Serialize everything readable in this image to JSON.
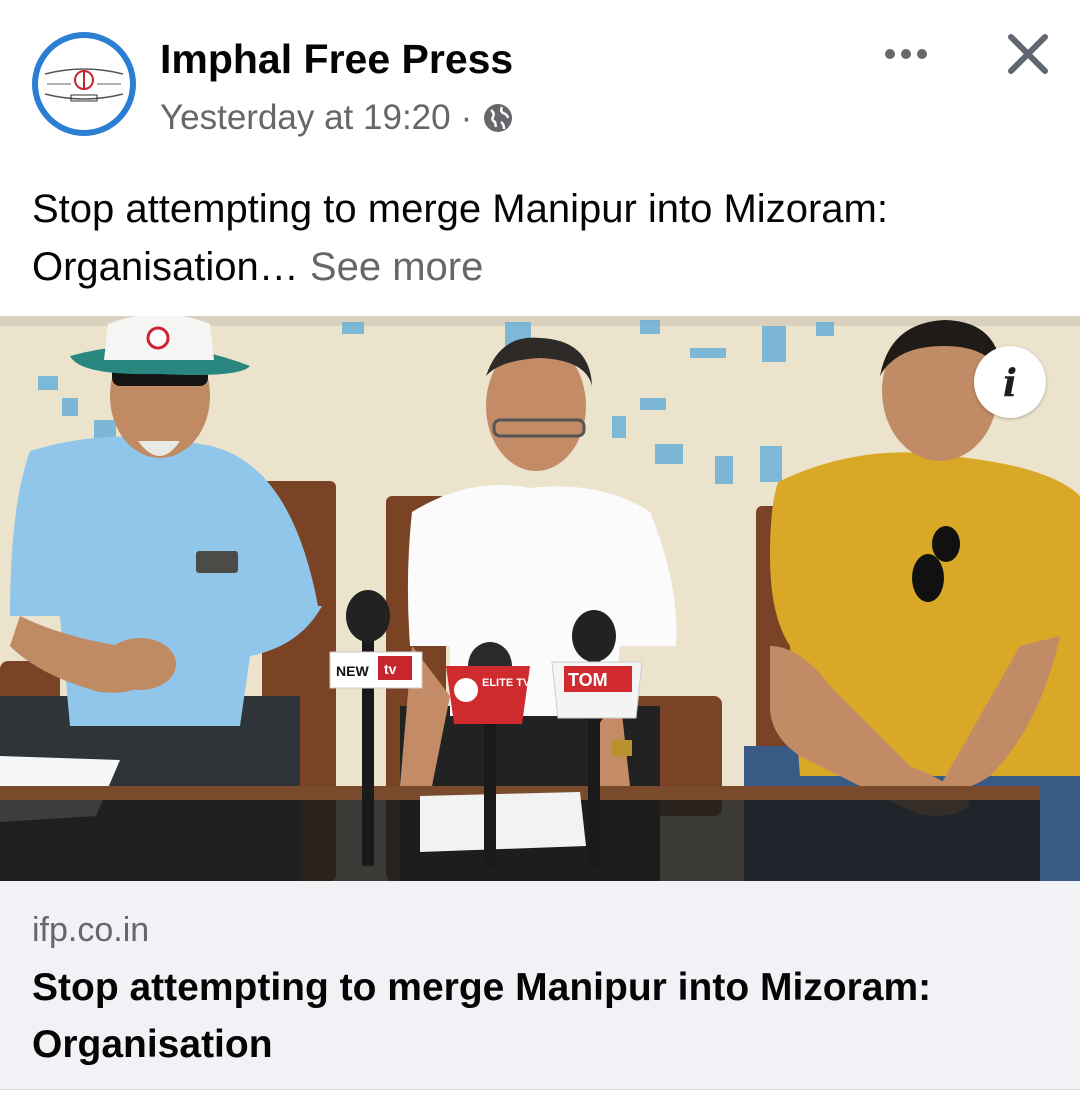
{
  "post": {
    "page_name": "Imphal Free Press",
    "timestamp": "Yesterday at 19:20",
    "separator": "·",
    "privacy_icon": "globe-icon",
    "caption_text": "Stop attempting to merge Manipur into Mizoram: Organisation…",
    "see_more_label": "See more",
    "more_icon": "ellipsis-icon",
    "close_icon": "close-icon"
  },
  "photo": {
    "info_label": "i",
    "mic_labels": {
      "new_tv": "NEW",
      "new_tv_badge": "tv",
      "elite": "ELITE TV",
      "tom": "TOM"
    }
  },
  "link_preview": {
    "domain": "ifp.co.in",
    "title": "Stop attempting to merge Manipur into Mizoram: Organisation"
  },
  "colors": {
    "accent_blue": "#2a7fd4",
    "secondary_text": "#65676b",
    "link_background": "#f0f2f5"
  }
}
